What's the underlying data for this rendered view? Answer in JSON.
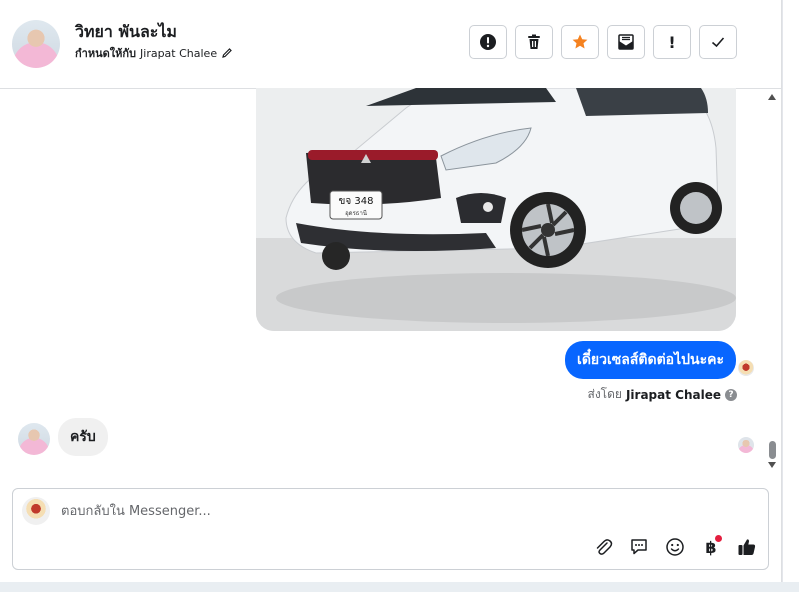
{
  "header": {
    "contact_name": "วิทยา พันละไม",
    "assign_label": "กำหนดให้กับ",
    "assignee": "Jirapat Chalee",
    "actions": [
      {
        "name": "spam",
        "icon": "alert-circle-icon"
      },
      {
        "name": "delete",
        "icon": "trash-icon"
      },
      {
        "name": "star",
        "icon": "star-icon",
        "color": "#f5821f"
      },
      {
        "name": "mark-unread",
        "icon": "envelope-icon"
      },
      {
        "name": "follow-up",
        "icon": "exclamation-icon",
        "text": "!"
      },
      {
        "name": "done",
        "icon": "check-icon"
      }
    ]
  },
  "conversation": {
    "image": {
      "plate_line1": "ขจ 348",
      "plate_line2": "อุดรธานี"
    },
    "sent_message": "เดี๋ยวเซลส์ติดต่อไปนะคะ",
    "sent_by_label": "ส่งโดย",
    "sent_by_name": "Jirapat Chalee",
    "help_icon_glyph": "?",
    "received_message": "ครับ"
  },
  "composer": {
    "placeholder": "ตอบกลับใน Messenger...",
    "tools": [
      "paperclip-icon",
      "chat-bubble-icon",
      "emoji-icon",
      "baht-icon",
      "thumbs-up-icon"
    ],
    "baht_glyph": "฿"
  },
  "colors": {
    "accent": "#0866ff",
    "star": "#f5821f",
    "notification_dot": "#e41e3f"
  }
}
